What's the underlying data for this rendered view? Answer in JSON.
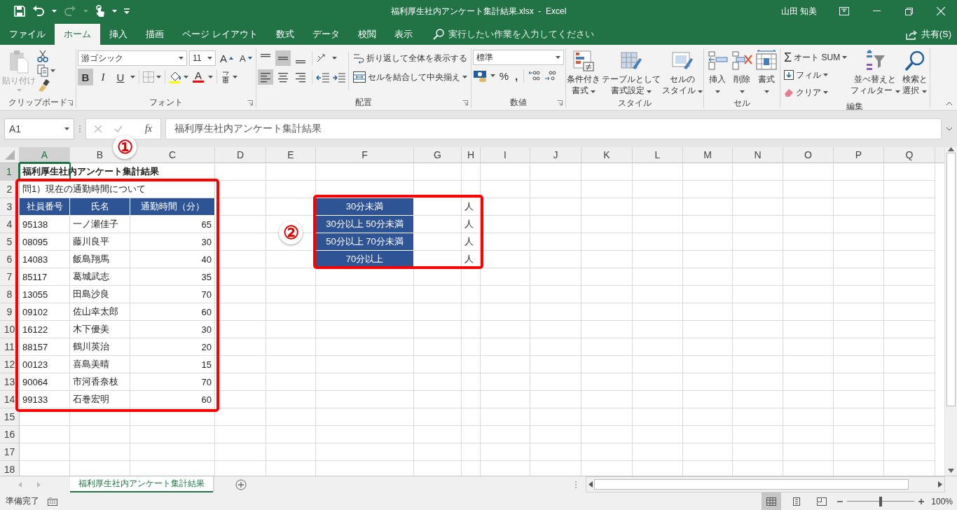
{
  "window": {
    "title": "福利厚生社内アンケート集計結果.xlsx  -  Excel",
    "user": "山田 知美"
  },
  "tabs": [
    {
      "label": "ファイル",
      "selected": false
    },
    {
      "label": "ホーム",
      "selected": true
    },
    {
      "label": "挿入",
      "selected": false
    },
    {
      "label": "描画",
      "selected": false
    },
    {
      "label": "ページ レイアウト",
      "selected": false
    },
    {
      "label": "数式",
      "selected": false
    },
    {
      "label": "データ",
      "selected": false
    },
    {
      "label": "校閲",
      "selected": false
    },
    {
      "label": "表示",
      "selected": false
    }
  ],
  "tell_me": {
    "placeholder": "実行したい作業を入力してください"
  },
  "share": "共有(S)",
  "ribbon": {
    "clipboard": {
      "label": "クリップボード",
      "paste": "貼り付け",
      "paste_disabled": true
    },
    "font": {
      "label": "フォント",
      "font_name": "游ゴシック",
      "font_size": "11",
      "grow": "A",
      "shrink": "A",
      "color_glyph": "A",
      "buttons": [
        {
          "label": "B",
          "selected": true
        },
        {
          "label": "I",
          "selected": false
        },
        {
          "label": "U",
          "selected": false
        }
      ]
    },
    "alignment": {
      "label": "配置",
      "wrap_text": "折り返して全体を表示する",
      "merge": "セルを結合して中央揃え",
      "middle_align": true,
      "left_align": true
    },
    "number": {
      "label": "数値",
      "format": "標準",
      "percent": "%",
      "comma": ","
    },
    "styles": {
      "label": "スタイル",
      "buttons": [
        {
          "lines": [
            "条件付き",
            "書式"
          ]
        },
        {
          "lines": [
            "テーブルとして",
            "書式設定"
          ]
        },
        {
          "lines": [
            "セルの",
            "スタイル"
          ]
        }
      ]
    },
    "cells": {
      "label": "セル",
      "buttons": [
        "挿入",
        "削除",
        "書式"
      ]
    },
    "editing": {
      "label": "編集",
      "sigma": "Σ",
      "autosum": "オート SUM",
      "fill": "フィル",
      "clear": "クリア",
      "sort": [
        "並べ替えと",
        "フィルター"
      ],
      "find": [
        "検索と",
        "選択"
      ]
    }
  },
  "formula_bar": {
    "name_box": "A1",
    "fx": "fx",
    "formula": "福利厚生社内アンケート集計結果"
  },
  "sheet": {
    "columns": [
      {
        "label": "A",
        "selected": true
      },
      {
        "label": "B",
        "selected": false
      },
      {
        "label": "C",
        "selected": false
      },
      {
        "label": "D",
        "selected": false
      },
      {
        "label": "E",
        "selected": false
      },
      {
        "label": "F",
        "selected": false
      },
      {
        "label": "G",
        "selected": false
      },
      {
        "label": "H",
        "selected": false
      },
      {
        "label": "I",
        "selected": false
      },
      {
        "label": "J",
        "selected": false
      },
      {
        "label": "K",
        "selected": false
      },
      {
        "label": "L",
        "selected": false
      },
      {
        "label": "M",
        "selected": false
      },
      {
        "label": "N",
        "selected": false
      },
      {
        "label": "O",
        "selected": false
      },
      {
        "label": "P",
        "selected": false
      },
      {
        "label": "Q",
        "selected": false
      }
    ],
    "rows": [
      {
        "label": "1",
        "selected": true
      },
      {
        "label": "2",
        "selected": false
      },
      {
        "label": "3",
        "selected": false
      },
      {
        "label": "4",
        "selected": false
      },
      {
        "label": "5",
        "selected": false
      },
      {
        "label": "6",
        "selected": false
      },
      {
        "label": "7",
        "selected": false
      },
      {
        "label": "8",
        "selected": false
      },
      {
        "label": "9",
        "selected": false
      },
      {
        "label": "10",
        "selected": false
      },
      {
        "label": "11",
        "selected": false
      },
      {
        "label": "12",
        "selected": false
      },
      {
        "label": "13",
        "selected": false
      },
      {
        "label": "14",
        "selected": false
      },
      {
        "label": "15",
        "selected": false
      },
      {
        "label": "16",
        "selected": false
      },
      {
        "label": "17",
        "selected": false
      },
      {
        "label": "18",
        "selected": false
      }
    ],
    "title": "福利厚生社内アンケート集計結果",
    "question": "問1）現在の通勤時間について",
    "survey": {
      "headers": [
        "社員番号",
        "氏名",
        "通勤時間（分）"
      ],
      "rows": [
        [
          "95138",
          "一ノ瀬佳子",
          "65"
        ],
        [
          "08095",
          "藤川良平",
          "30"
        ],
        [
          "14083",
          "飯島翔馬",
          "40"
        ],
        [
          "85117",
          "葛城武志",
          "35"
        ],
        [
          "13055",
          "田島沙良",
          "70"
        ],
        [
          "09102",
          "佐山幸太郎",
          "60"
        ],
        [
          "16122",
          "木下優美",
          "30"
        ],
        [
          "88157",
          "鶴川英治",
          "20"
        ],
        [
          "00123",
          "喜島美晴",
          "15"
        ],
        [
          "90064",
          "市河香奈枝",
          "70"
        ],
        [
          "99133",
          "石巻宏明",
          "60"
        ]
      ]
    },
    "summary": [
      {
        "label": "30分未満",
        "unit": "人"
      },
      {
        "label": "30分以上 50分未満",
        "unit": "人"
      },
      {
        "label": "50分以上 70分未満",
        "unit": "人"
      },
      {
        "label": "70分以上",
        "unit": "人"
      }
    ],
    "callouts": [
      "①",
      "②"
    ]
  },
  "sheet_tabs": [
    {
      "label": "福利厚生社内アンケート集計結果",
      "selected": true
    }
  ],
  "status_bar": {
    "status": "準備完了",
    "views": [
      {
        "selected": true
      },
      {
        "selected": false
      },
      {
        "selected": false
      }
    ],
    "zoom_slider": {
      "level": 0.5
    },
    "zoom": "100%"
  }
}
